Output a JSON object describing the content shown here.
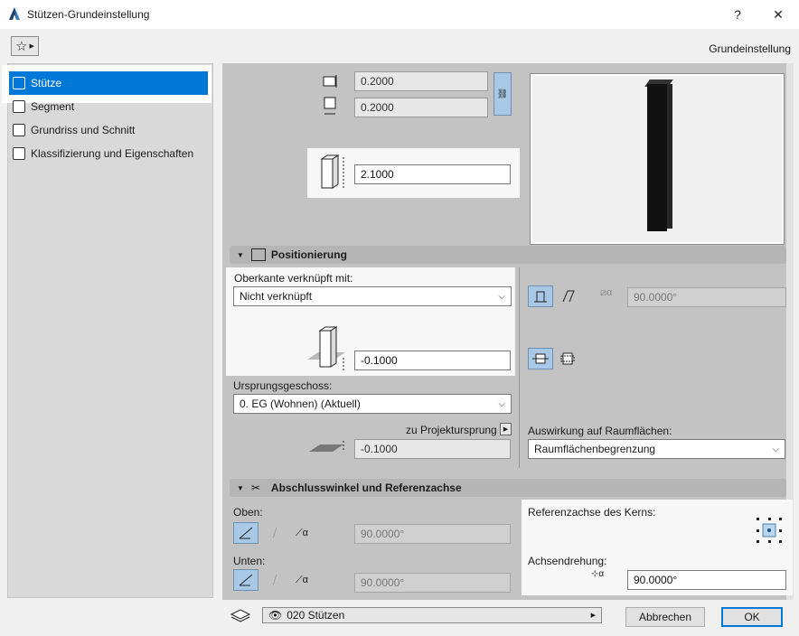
{
  "window": {
    "title": "Stützen-Grundeinstellung",
    "help_label": "?",
    "close_label": "✕"
  },
  "topbar": {
    "settings_label": "Grundeinstellung"
  },
  "sidebar": {
    "items": [
      {
        "label": "Stütze"
      },
      {
        "label": "Segment"
      },
      {
        "label": "Grundriss und Schnitt"
      },
      {
        "label": "Klassifizierung und Eigenschaften"
      }
    ]
  },
  "dimensions": {
    "width": "0.2000",
    "depth": "0.2000",
    "height": "2.1000"
  },
  "positioning": {
    "header": "Positionierung",
    "top_linked_label": "Oberkante verknüpft mit:",
    "top_linked_value": "Nicht verknüpft",
    "offset_value": "-0.1000",
    "home_story_label": "Ursprungsgeschoss:",
    "home_story_value": "0. EG (Wohnen) (Aktuell)",
    "to_origin_label": "zu Projektursprung",
    "origin_offset": "-0.1000",
    "slant_angle": "90.0000°",
    "zone_label": "Auswirkung auf Raumflächen:",
    "zone_value": "Raumflächenbegrenzung"
  },
  "end_angles": {
    "header": "Abschlusswinkel und Referenzachse",
    "top_label": "Oben:",
    "top_angle": "90.0000°",
    "bottom_label": "Unten:",
    "bottom_angle": "90.0000°",
    "core_axis_label": "Referenzachse des Kerns:",
    "rotation_label": "Achsendrehung:",
    "rotation_value": "90.0000°"
  },
  "footer": {
    "layer_value": "020 Stützen",
    "cancel_label": "Abbrechen",
    "ok_label": "OK"
  }
}
